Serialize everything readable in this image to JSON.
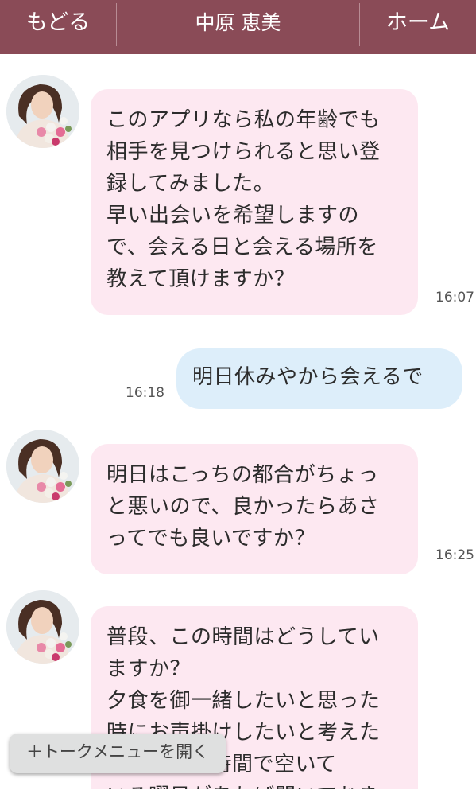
{
  "header": {
    "back_label": "もどる",
    "title": "中原 恵美",
    "home_label": "ホーム",
    "background_color": "#8a4b57"
  },
  "messages": [
    {
      "from": "other",
      "text": "このアプリなら私の年齢でも\n相手を見つけられると思い登\n録してみました。\n早い出会いを希望しますの\nで、会える日と会える場所を\n教えて頂けますか？",
      "time": "16:07"
    },
    {
      "from": "me",
      "text": "明日休みやから会えるで",
      "time": "16:18"
    },
    {
      "from": "other",
      "text": "明日はこっちの都合がちょっ\nと悪いので、良かったらあさ\nってでも良いですか？",
      "time": "16:25"
    },
    {
      "from": "other",
      "text": "普段、この時間はどうしてい\nますか？\n夕食を御一緒したいと思った\n時にお声掛けしたいと考えた\nので、この時間で空いて\nいる曜日があれば聞いておき",
      "time": ""
    }
  ],
  "menu_button_label": "＋トークメニューを開く",
  "colors": {
    "incoming_bubble": "#fde8f1",
    "outgoing_bubble": "#ddeefa"
  },
  "icons": {
    "avatar": "profile-photo-woman-with-flowers"
  }
}
